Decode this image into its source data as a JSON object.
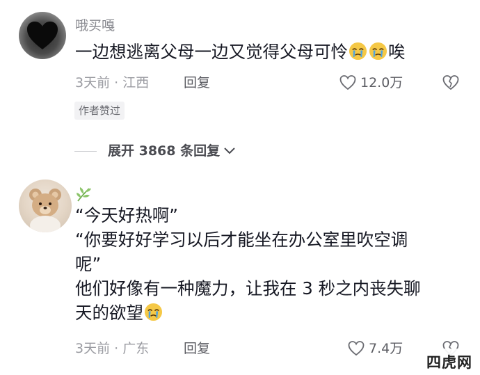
{
  "comments": [
    {
      "username": "哦买嘎",
      "text_before_emoji": "一边想逃离父母一边又觉得父母可怜",
      "emoji_icons": [
        "crying-face-icon",
        "crying-face-icon"
      ],
      "text_after_emoji": "唉",
      "meta": "3天前 · 江西",
      "reply_label": "回复",
      "like_count": "12.0万",
      "author_badge": "作者赞过",
      "expand_label": "展开 3868 条回复"
    },
    {
      "username_icon": "leaf-sprout-icon",
      "lines": [
        "“今天好热啊”",
        "“你要好好学习以后才能坐在办公室里吹空调",
        "呢”",
        "他们好像有一种魔力，让我在 3 秒之内丧失聊",
        "天的欲望"
      ],
      "emoji_icons": [
        "crying-face-icon"
      ],
      "meta": "3天前 · 广东",
      "reply_label": "回复",
      "like_count": "7.4万"
    }
  ],
  "watermark": "四虎网",
  "colors": {
    "text_primary": "#161823",
    "text_secondary": "#8a8b91",
    "badge_bg": "#f2f2f4",
    "emoji_face": "#f5c846",
    "emoji_tear": "#4fa3e0"
  }
}
